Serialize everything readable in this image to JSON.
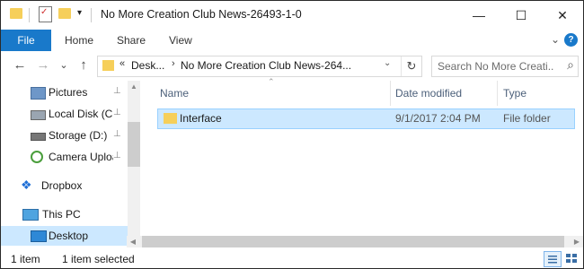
{
  "window": {
    "title": "No More Creation Club News-26493-1-0",
    "minimize_glyph": "—",
    "maximize_glyph": "☐",
    "close_glyph": "✕"
  },
  "quick_access": {
    "dropdown_glyph": "▾"
  },
  "ribbon": {
    "tabs": [
      "File",
      "Home",
      "Share",
      "View"
    ],
    "expand_glyph": "⌄",
    "help_glyph": "?"
  },
  "address": {
    "back_glyph": "←",
    "forward_glyph": "→",
    "recent_glyph": "⌄",
    "up_glyph": "↑",
    "overflow": "«",
    "crumbs": [
      "Desk...",
      "No More Creation Club News-264..."
    ],
    "separator": "›",
    "dropdown_glyph": "⌄",
    "refresh_glyph": "↻"
  },
  "search": {
    "placeholder": "Search No More Creati...",
    "icon": "search-icon"
  },
  "nav_pane": {
    "items": [
      {
        "label": "Pictures",
        "icon": "pictures-icon",
        "pinned": true
      },
      {
        "label": "Local Disk (C:)",
        "icon": "drive-icon",
        "pinned": true
      },
      {
        "label": "Storage (D:)",
        "icon": "drive-icon",
        "pinned": true
      },
      {
        "label": "Camera Uploads",
        "icon": "camera-icon",
        "pinned": true
      },
      {
        "label": "Dropbox",
        "icon": "dropbox-icon",
        "pinned": false
      },
      {
        "label": "This PC",
        "icon": "computer-icon",
        "pinned": false
      },
      {
        "label": "Desktop",
        "icon": "desktop-icon",
        "pinned": false,
        "selected": true
      }
    ],
    "pin_glyph": "📌"
  },
  "content": {
    "columns": [
      "Name",
      "Date modified",
      "Type"
    ],
    "rows": [
      {
        "name": "Interface",
        "date_modified": "9/1/2017 2:04 PM",
        "type": "File folder",
        "selected": true
      }
    ]
  },
  "status_bar": {
    "item_count": "1 item",
    "selected_count": "1 item selected"
  },
  "colors": {
    "accent": "#1979ca",
    "selection": "#cce8ff",
    "selection_border": "#99d1ff",
    "folder": "#f6cf5a"
  }
}
